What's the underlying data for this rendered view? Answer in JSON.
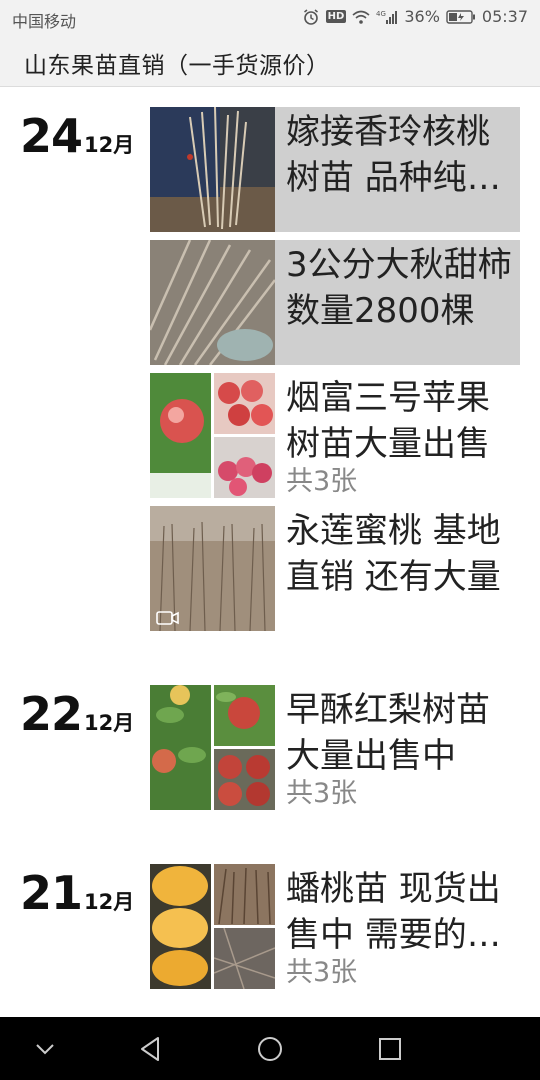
{
  "status_bar": {
    "carrier": "中国移动",
    "network": "4G",
    "battery_percent": "36%",
    "time": "05:37",
    "hd_label": "HD"
  },
  "header": {
    "title": "山东果苗直销（一手货源价）"
  },
  "groups": [
    {
      "day": "24",
      "month": "12月",
      "posts": [
        {
          "text": "嫁接香玲核桃树苗 品种纯正 基地直销",
          "image_count": "",
          "highlighted": true,
          "video": false
        },
        {
          "text": "3公分大秋甜柿数量2800棵",
          "image_count": "",
          "highlighted": true,
          "video": false
        },
        {
          "text": "烟富三号苹果树苗大量出售",
          "image_count": "共3张",
          "highlighted": false,
          "video": false
        },
        {
          "text": "永莲蜜桃 基地直销 还有大量",
          "image_count": "",
          "highlighted": false,
          "video": true
        }
      ]
    },
    {
      "day": "22",
      "month": "12月",
      "posts": [
        {
          "text": "早酥红梨树苗大量出售中",
          "image_count": "共3张",
          "highlighted": false,
          "video": false
        }
      ]
    },
    {
      "day": "21",
      "month": "12月",
      "posts": [
        {
          "text": "蟠桃苗 现货出售中 需要的联系",
          "image_count": "共3张",
          "highlighted": false,
          "video": false
        }
      ]
    }
  ]
}
